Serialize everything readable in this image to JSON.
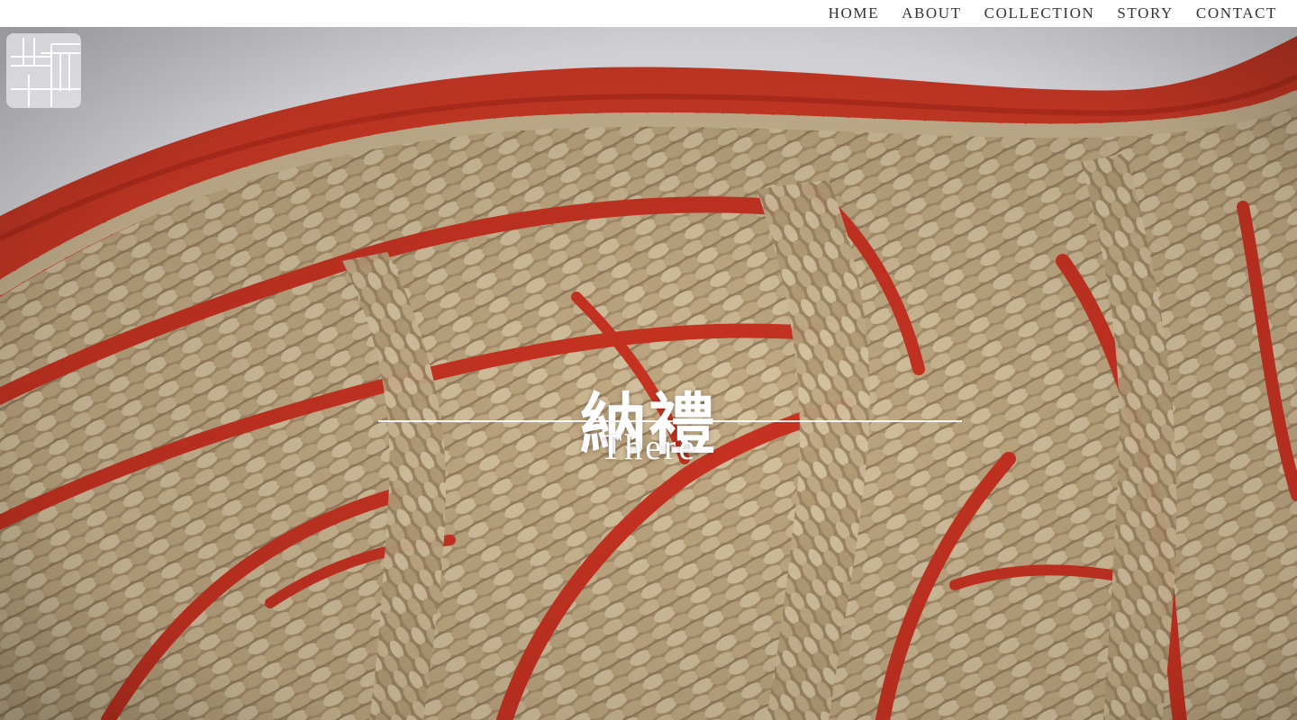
{
  "nav": {
    "items": [
      {
        "label": "HOME"
      },
      {
        "label": "ABOUT"
      },
      {
        "label": "COLLECTION"
      },
      {
        "label": "STORY"
      },
      {
        "label": "CONTACT"
      }
    ]
  },
  "hero": {
    "title": "納禮",
    "subtitle": "There",
    "image_subject": "red fabric with braided jute embroidery",
    "colors": {
      "fabric_red": "#d23a26",
      "braid": "#b9a27f",
      "backdrop": "#e8e8ee"
    }
  },
  "logo": {
    "icon": "grid-logo-icon"
  }
}
